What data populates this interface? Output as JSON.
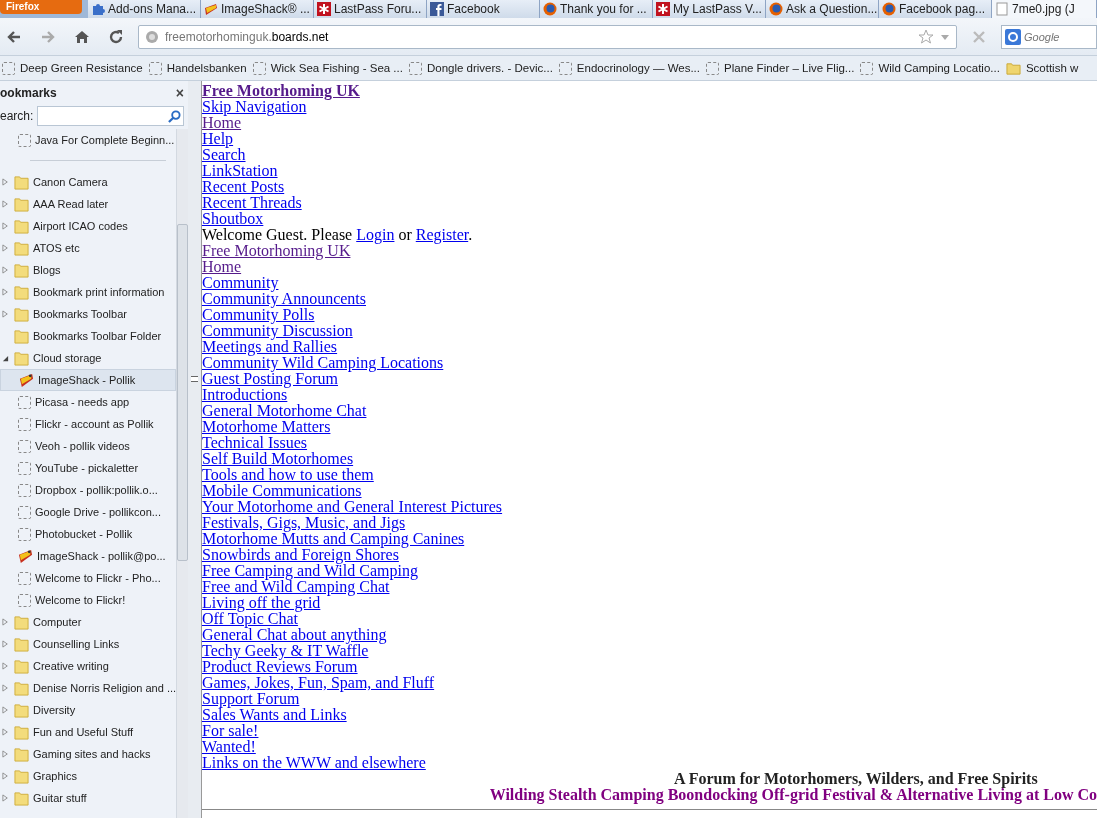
{
  "menu_button": {
    "label": "Firefox"
  },
  "tabs": [
    {
      "label": "Add-ons Mana...",
      "kind": "puzzle",
      "selected": false
    },
    {
      "label": "ImageShack® ...",
      "kind": "imageshack",
      "selected": false
    },
    {
      "label": "LastPass Foru...",
      "kind": "lastpass",
      "selected": false
    },
    {
      "label": "Facebook",
      "kind": "facebook",
      "selected": false
    },
    {
      "label": "Thank you for ...",
      "kind": "firefox",
      "selected": false
    },
    {
      "label": "My LastPass V...",
      "kind": "lastpass",
      "selected": false
    },
    {
      "label": "Ask a Question...",
      "kind": "firefox",
      "selected": false
    },
    {
      "label": "Facebook pag...",
      "kind": "firefox",
      "selected": false
    },
    {
      "label": "7me0.jpg (J",
      "kind": "image",
      "selected": true
    }
  ],
  "address": {
    "prefix": "freemotorhominguk.",
    "domain": "boards.net"
  },
  "search": {
    "placeholder": "Google"
  },
  "bookmarks_bar": [
    {
      "label": "Deep Green Resistance",
      "kind": "page"
    },
    {
      "label": "Handelsbanken",
      "kind": "page"
    },
    {
      "label": "Wick Sea Fishing - Sea ...",
      "kind": "page"
    },
    {
      "label": "Dongle drivers. - Devic...",
      "kind": "page"
    },
    {
      "label": "Endocrinology — Wes...",
      "kind": "page"
    },
    {
      "label": "Plane Finder – Live Flig...",
      "kind": "page"
    },
    {
      "label": "Wild Camping Locatio...",
      "kind": "page"
    },
    {
      "label": "Scottish w",
      "kind": "folder"
    }
  ],
  "sidebar": {
    "title": "ookmarks",
    "close_glyph": "×",
    "search_label": "earch:",
    "top_items": [
      {
        "label": "Java For Complete Beginn...",
        "kind": "page"
      }
    ],
    "items": [
      {
        "label": "Canon Camera",
        "kind": "folder",
        "expanded": false,
        "selected": false
      },
      {
        "label": "AAA Read later",
        "kind": "folder",
        "expanded": false,
        "selected": false
      },
      {
        "label": "Airport ICAO codes",
        "kind": "folder",
        "expanded": false,
        "selected": false
      },
      {
        "label": "ATOS etc",
        "kind": "folder",
        "expanded": false,
        "selected": false
      },
      {
        "label": "Blogs",
        "kind": "folder",
        "expanded": false,
        "selected": false
      },
      {
        "label": "Bookmark print information",
        "kind": "folder",
        "expanded": false,
        "selected": false
      },
      {
        "label": "Bookmarks Toolbar",
        "kind": "folder",
        "expanded": false,
        "selected": false
      },
      {
        "label": "Bookmarks Toolbar Folder",
        "kind": "empty-folder",
        "expanded": false,
        "selected": false
      },
      {
        "label": "Cloud storage",
        "kind": "folder",
        "expanded": true,
        "selected": false,
        "children": [
          {
            "label": "ImageShack - Pollik",
            "kind": "imageshack",
            "selected": true
          },
          {
            "label": "Picasa - needs app",
            "kind": "page",
            "selected": false
          },
          {
            "label": "Flickr - account as Pollik",
            "kind": "page",
            "selected": false
          },
          {
            "label": "Veoh - pollik videos",
            "kind": "page",
            "selected": false
          },
          {
            "label": "YouTube - pickaletter",
            "kind": "page",
            "selected": false
          },
          {
            "label": "Dropbox - pollik:pollik.o...",
            "kind": "page",
            "selected": false
          },
          {
            "label": "Google Drive - pollikcon...",
            "kind": "page",
            "selected": false
          },
          {
            "label": "Photobucket - Pollik",
            "kind": "page",
            "selected": false
          },
          {
            "label": "ImageShack - pollik@po...",
            "kind": "imageshack",
            "selected": false
          },
          {
            "label": "Welcome to Flickr - Pho...",
            "kind": "page",
            "selected": false
          },
          {
            "label": "Welcome to Flickr!",
            "kind": "page",
            "selected": false
          }
        ]
      },
      {
        "label": "Computer",
        "kind": "folder",
        "expanded": false,
        "selected": false
      },
      {
        "label": "Counselling Links",
        "kind": "folder",
        "expanded": false,
        "selected": false
      },
      {
        "label": "Creative writing",
        "kind": "folder",
        "expanded": false,
        "selected": false
      },
      {
        "label": "Denise Norris Religion and ...",
        "kind": "folder",
        "expanded": false,
        "selected": false
      },
      {
        "label": "Diversity",
        "kind": "folder",
        "expanded": false,
        "selected": false
      },
      {
        "label": "Fun and Useful Stuff",
        "kind": "folder",
        "expanded": false,
        "selected": false
      },
      {
        "label": "Gaming sites and hacks",
        "kind": "folder",
        "expanded": false,
        "selected": false
      },
      {
        "label": "Graphics",
        "kind": "folder",
        "expanded": false,
        "selected": false
      },
      {
        "label": "Guitar stuff",
        "kind": "folder",
        "expanded": false,
        "selected": false
      }
    ]
  },
  "page": {
    "lines": [
      {
        "kind": "title",
        "text": "Free Motorhoming UK"
      },
      {
        "kind": "link",
        "text": "Skip Navigation"
      },
      {
        "kind": "visited",
        "text": "Home"
      },
      {
        "kind": "link",
        "text": "Help"
      },
      {
        "kind": "link",
        "text": "Search"
      },
      {
        "kind": "link",
        "text": "LinkStation"
      },
      {
        "kind": "link",
        "text": "Recent Posts"
      },
      {
        "kind": "link",
        "text": "Recent Threads"
      },
      {
        "kind": "link",
        "text": "Shoutbox"
      },
      {
        "kind": "welcome",
        "parts": [
          {
            "kind": "text",
            "text": "Welcome Guest. Please "
          },
          {
            "kind": "link",
            "text": "Login"
          },
          {
            "kind": "text",
            "text": " or "
          },
          {
            "kind": "link",
            "text": "Register"
          },
          {
            "kind": "text",
            "text": "."
          }
        ]
      },
      {
        "kind": "visited",
        "text": "Free Motorhoming UK"
      },
      {
        "kind": "visited",
        "text": "Home"
      },
      {
        "kind": "link",
        "text": "Community"
      },
      {
        "kind": "link",
        "text": "Community Announcents"
      },
      {
        "kind": "link",
        "text": "Community Polls"
      },
      {
        "kind": "link",
        "text": "Community Discussion"
      },
      {
        "kind": "link",
        "text": "Meetings and Rallies"
      },
      {
        "kind": "link",
        "text": "Community Wild Camping Locations"
      },
      {
        "kind": "link",
        "text": "Guest Posting Forum"
      },
      {
        "kind": "link",
        "text": "Introductions"
      },
      {
        "kind": "link",
        "text": "General Motorhome Chat"
      },
      {
        "kind": "link",
        "text": "Motorhome Matters"
      },
      {
        "kind": "link",
        "text": "Technical Issues"
      },
      {
        "kind": "link",
        "text": "Self Build Motorhomes"
      },
      {
        "kind": "link",
        "text": "Tools and how to use them"
      },
      {
        "kind": "link",
        "text": "Mobile Communications"
      },
      {
        "kind": "link",
        "text": "Your Motorhome and General Interest Pictures"
      },
      {
        "kind": "link",
        "text": "Festivals, Gigs, Music, and Jigs"
      },
      {
        "kind": "link",
        "text": "Motorhome Mutts and Camping Canines"
      },
      {
        "kind": "link",
        "text": "Snowbirds and Foreign Shores"
      },
      {
        "kind": "link",
        "text": "Free Camping and Wild Camping"
      },
      {
        "kind": "link",
        "text": "Free and Wild Camping Chat"
      },
      {
        "kind": "link",
        "text": "Living off the grid"
      },
      {
        "kind": "link",
        "text": "Off Topic Chat"
      },
      {
        "kind": "link",
        "text": "General Chat about anything"
      },
      {
        "kind": "link",
        "text": "Techy Geeky & IT Waffle"
      },
      {
        "kind": "link",
        "text": "Product Reviews Forum"
      },
      {
        "kind": "link",
        "text": "Games, Jokes, Fun, Spam, and Fluff"
      },
      {
        "kind": "link",
        "text": "Support Forum"
      },
      {
        "kind": "link",
        "text": "Sales Wants and Links"
      },
      {
        "kind": "link",
        "text": "For sale!"
      },
      {
        "kind": "link",
        "text": "Wanted!"
      },
      {
        "kind": "link",
        "text": "Links on the WWW and elsewhere"
      }
    ],
    "tagline": "A Forum for Motorhomers, Wilders, and Free Spirits",
    "subtagline": "Wilding Stealth Camping Boondocking Off-grid Festival & Alternative Living at Low Co"
  }
}
